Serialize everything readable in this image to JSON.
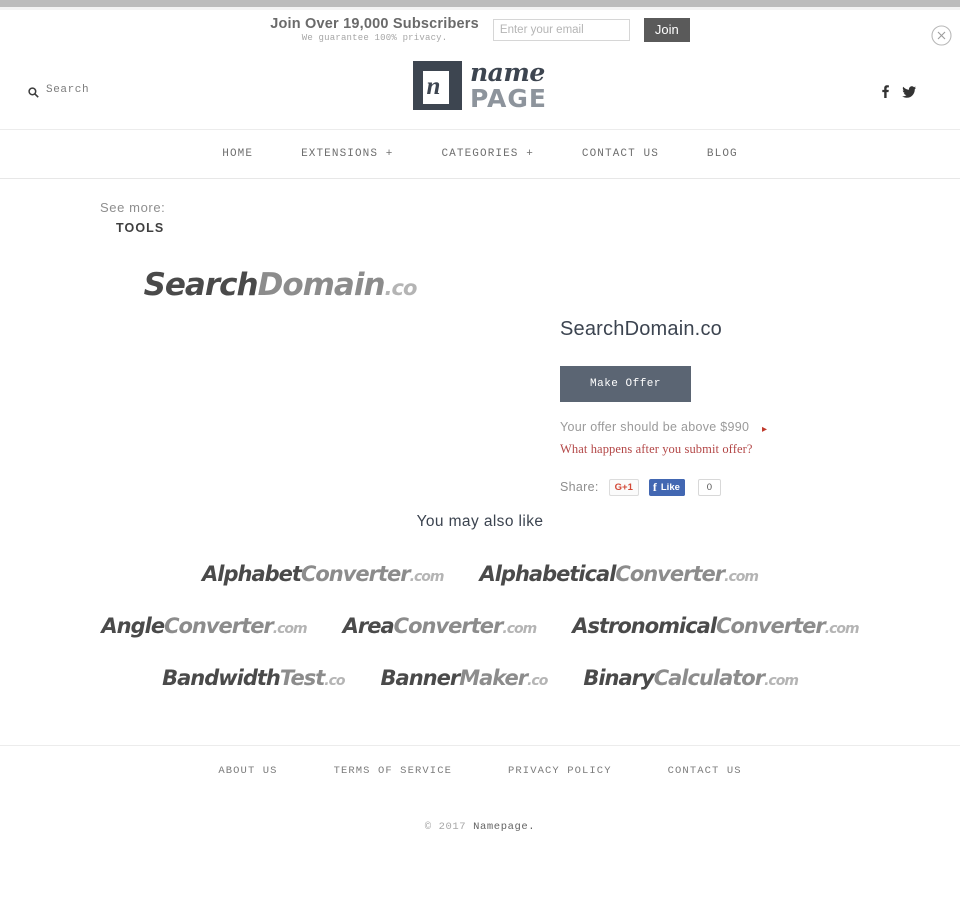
{
  "promo": {
    "headline": "Join Over 19,000 Subscribers",
    "subtext": "We guarantee 100% privacy.",
    "email_placeholder": "Enter your email",
    "email_value": "",
    "join_label": "Join",
    "close_icon": "close-circle-icon"
  },
  "header": {
    "search_label": "Search",
    "search_icon": "search-icon",
    "logo": {
      "mark_letter": "n",
      "word_script": "name",
      "word_bold": "PAGE"
    },
    "social": [
      {
        "name": "facebook-icon",
        "label": "f"
      },
      {
        "name": "twitter-icon",
        "label": "t"
      }
    ]
  },
  "nav": {
    "items": [
      {
        "label": "HOME"
      },
      {
        "label": "EXTENSIONS +"
      },
      {
        "label": "CATEGORIES +"
      },
      {
        "label": "CONTACT US"
      },
      {
        "label": "BLOG"
      }
    ]
  },
  "see_more": {
    "label": "See more:",
    "value": "TOOLS"
  },
  "product": {
    "wordmark": {
      "part1": "Search",
      "part2": "Domain",
      "part3": ".co"
    },
    "title": "SearchDomain.co",
    "make_offer_label": "Make Offer",
    "offer_note": "Your offer should be above $990",
    "offer_arrow": "▸",
    "offer_link": "What happens after you submit offer?",
    "share": {
      "label": "Share:",
      "gplus_label": "G+1",
      "fb_f": "f",
      "fb_like_label": "Like",
      "fb_count": "0"
    }
  },
  "also_like": {
    "title": "You may also like",
    "rows": [
      [
        {
          "part1": "Alphabet",
          "part2": "Converter",
          "part3": ".com"
        },
        {
          "part1": "Alphabetical",
          "part2": "Converter",
          "part3": ".com"
        }
      ],
      [
        {
          "part1": "Angle",
          "part2": "Converter",
          "part3": ".com"
        },
        {
          "part1": "Area",
          "part2": "Converter",
          "part3": ".com"
        },
        {
          "part1": "Astronomical",
          "part2": "Converter",
          "part3": ".com"
        }
      ],
      [
        {
          "part1": "Bandwidth",
          "part2": "Test",
          "part3": ".co"
        },
        {
          "part1": "Banner",
          "part2": "Maker",
          "part3": ".co"
        },
        {
          "part1": "Binary",
          "part2": "Calculator",
          "part3": ".com"
        }
      ]
    ]
  },
  "footer": {
    "links": [
      {
        "label": "ABOUT US"
      },
      {
        "label": "TERMS OF SERVICE"
      },
      {
        "label": "PRIVACY POLICY"
      },
      {
        "label": "CONTACT US"
      }
    ],
    "copyright_year": "© 2017 ",
    "copyright_name": "Namepage."
  },
  "colors": {
    "accent_red": "#b34747",
    "button_slate": "#5b6573",
    "logo_dark": "#3d4550",
    "facebook_blue": "#4267b2",
    "gplus_red": "#d34836"
  }
}
